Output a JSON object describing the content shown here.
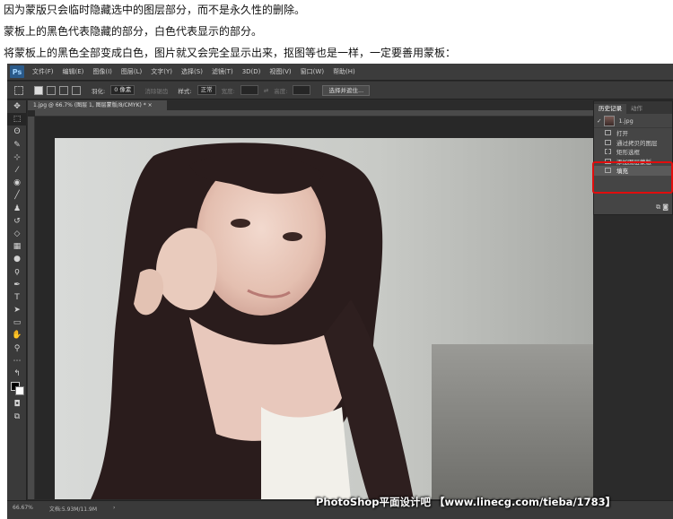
{
  "captions": [
    "因为蒙版只会临时隐藏选中的图层部分，而不是永久性的删除。",
    "蒙板上的黑色代表隐藏的部分，白色代表显示的部分。",
    "将蒙板上的黑色全部变成白色，图片就又会完全显示出来，抠图等也是一样，一定要善用蒙板："
  ],
  "app": {
    "logo": "Ps"
  },
  "menubar": [
    "文件(F)",
    "编辑(E)",
    "图像(I)",
    "图层(L)",
    "文字(Y)",
    "选择(S)",
    "滤镜(T)",
    "3D(D)",
    "视图(V)",
    "窗口(W)",
    "帮助(H)"
  ],
  "options": {
    "feather_label": "羽化:",
    "feather_value": "0 像素",
    "antialias": "消除锯齿",
    "style_label": "样式:",
    "style_value": "正常",
    "width_label": "宽度:",
    "height_label": "高度:",
    "select_mask_button": "选择并遮住..."
  },
  "document": {
    "tab_title": "1.jpg @ 66.7% (图层 1, 图层蒙版/8/CMYK) *"
  },
  "history_panel": {
    "tabs": [
      "历史记录",
      "动作"
    ],
    "snapshot": "1.jpg",
    "items": [
      "打开",
      "通过拷贝的图层",
      "矩形选框",
      "添加图层蒙版",
      "填充"
    ],
    "selected_index": 4
  },
  "status": {
    "zoom": "66.67%",
    "doc_info": "文档:5.93M/11.9M"
  },
  "watermark": "PhotoShop平面设计吧 【www.linecg.com/tieba/1783】",
  "colors": {
    "highlight": "#e10d0d",
    "ps_dark": "#2b2b2b"
  }
}
